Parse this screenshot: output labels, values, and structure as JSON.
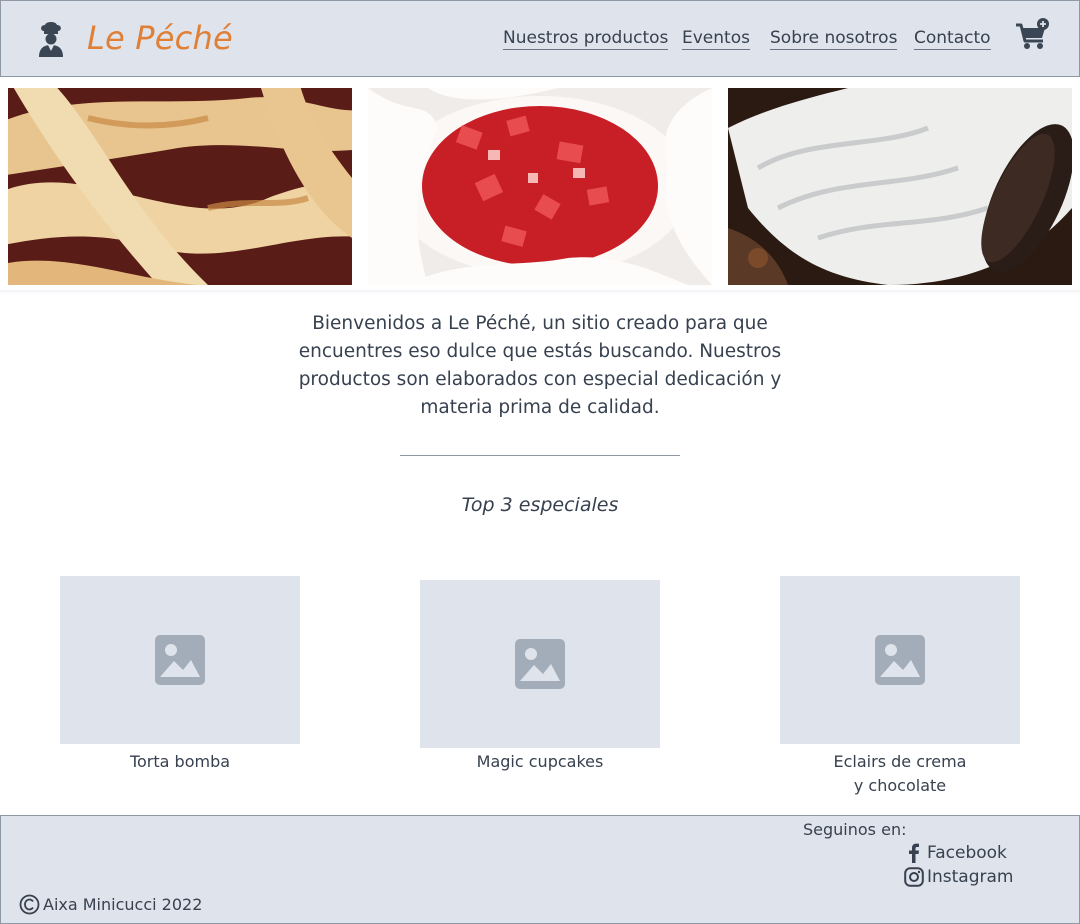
{
  "header": {
    "brand": "Le Péché",
    "logo_icon": "chef-icon",
    "cart_icon": "cart-add-icon",
    "brand_color": "#e07f36",
    "nav": [
      {
        "label": "Nuestros productos"
      },
      {
        "label": "Eventos"
      },
      {
        "label": "Sobre nosotros"
      },
      {
        "label": "Contacto"
      }
    ]
  },
  "gallery": [
    {
      "subject": "pastafrola"
    },
    {
      "subject": "strawberry-cream"
    },
    {
      "subject": "cookie-cream"
    }
  ],
  "intro": {
    "text": "Bienvenidos a Le Péché, un sitio creado para que encuentres eso dulce que estás buscando. Nuestros productos son elaborados con especial dedicación y materia prima de calidad."
  },
  "specials": {
    "title": "Top 3 especiales",
    "items": [
      {
        "name": "Torta bomba",
        "icon": "image-placeholder-icon"
      },
      {
        "name": "Magic cupcakes",
        "icon": "image-placeholder-icon"
      },
      {
        "name": "Eclairs de crema\ny chocolate",
        "icon": "image-placeholder-icon"
      }
    ]
  },
  "footer": {
    "follow_label": "Seguinos en:",
    "social": [
      {
        "label": "Facebook",
        "icon": "facebook-icon"
      },
      {
        "label": "Instagram",
        "icon": "instagram-icon"
      }
    ],
    "copyright": "Aixa Minicucci 2022",
    "copyright_icon": "copyright-icon"
  },
  "colors": {
    "header_bg": "#dfe4ec",
    "text": "#37414f",
    "placeholder_icon": "#a3adb9"
  }
}
